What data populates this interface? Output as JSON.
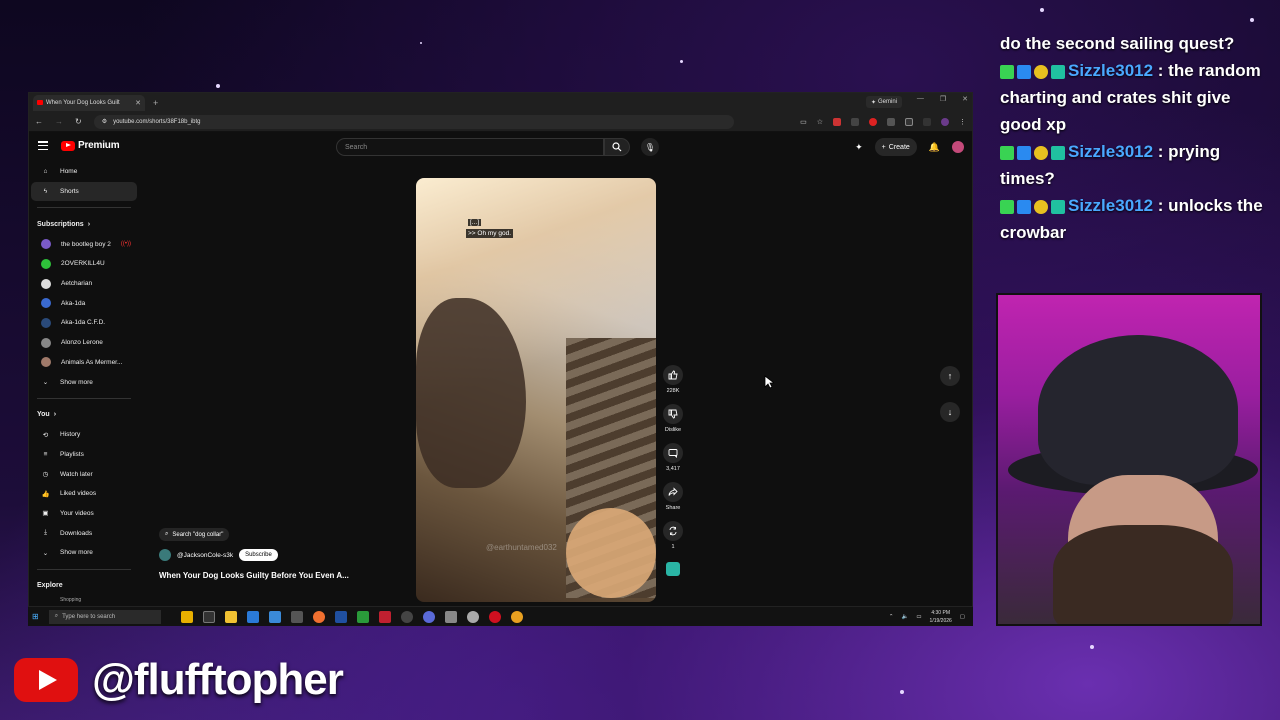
{
  "browser": {
    "tab_title": "When Your Dog Looks Guilt",
    "gemini_label": "Gemini",
    "url": "youtube.com/shorts/38F18b_ibtg"
  },
  "youtube": {
    "brand": "Premium",
    "search_placeholder": "Search",
    "create_label": "Create",
    "sidebar": {
      "home": "Home",
      "shorts": "Shorts",
      "subscriptions_heading": "Subscriptions",
      "channels": [
        {
          "name": "the bootleg boy 2",
          "color": "#7a5ac8"
        },
        {
          "name": "2OVERKILL4U",
          "color": "#2ec23a"
        },
        {
          "name": "Aetcharian",
          "color": "#dddddd"
        },
        {
          "name": "Aka-1da",
          "color": "#3a6ad0"
        },
        {
          "name": "Aka-1da C.F.D.",
          "color": "#2a4a7a"
        },
        {
          "name": "Alonzo Lerone",
          "color": "#888888"
        },
        {
          "name": "Animals As Mermer...",
          "color": "#a07a6a"
        }
      ],
      "show_more_1": "Show more",
      "you_heading": "You",
      "you_items": [
        "History",
        "Playlists",
        "Watch later",
        "Liked videos",
        "Your videos",
        "Downloads"
      ],
      "show_more_2": "Show more",
      "explore_heading": "Explore",
      "explore_partial": "Shopping"
    },
    "short": {
      "caption_top": "[...]",
      "caption": ">> Oh my god.",
      "watermark": "@earthuntamed032",
      "search_chip": "Search \"dog collar\"",
      "channel": "@JacksonCole-s3k",
      "subscribe": "Subscribe",
      "title": "When Your Dog Looks Guilty Before You Even A...",
      "likes": "228K",
      "dislike": "Dislike",
      "comments": "3,417",
      "share": "Share",
      "remix": "1"
    }
  },
  "taskbar": {
    "search": "Type here to search",
    "time": "4:30 PM",
    "date": "1/19/2026"
  },
  "chat": {
    "line0": "do the second sailing quest?",
    "messages": [
      {
        "user": "Sizzle3012",
        "text": ": the random charting and crates shit give good xp"
      },
      {
        "user": "Sizzle3012",
        "text": ": prying times?"
      },
      {
        "user": "Sizzle3012",
        "text": ": unlocks the crowbar"
      }
    ]
  },
  "overlay": {
    "handle": "@flufftopher"
  }
}
